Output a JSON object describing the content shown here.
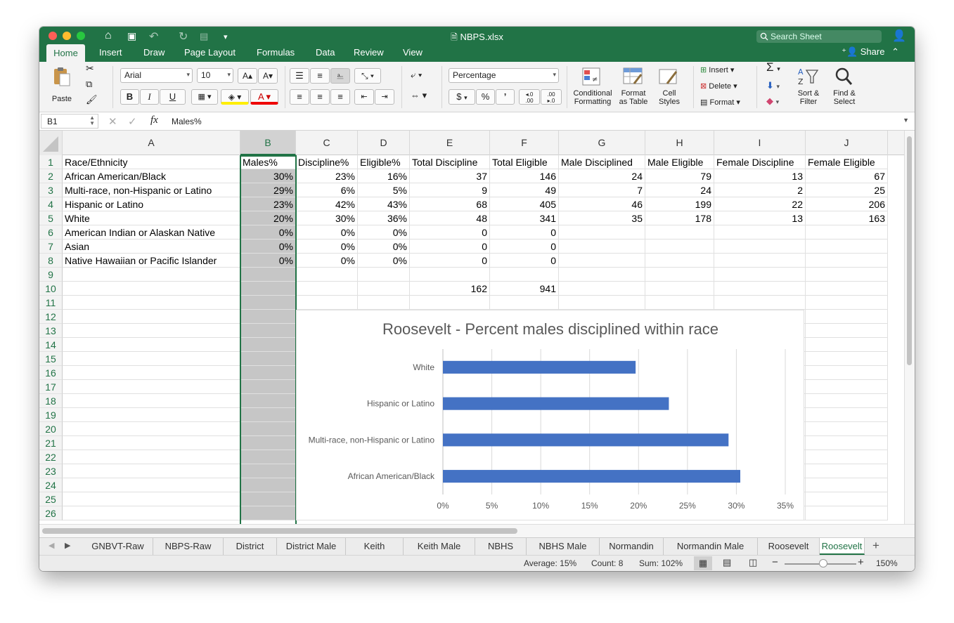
{
  "window": {
    "title": "NBPS.xlsx",
    "search_placeholder": "Search Sheet",
    "share_label": "Share"
  },
  "menu_tabs": [
    "Home",
    "Insert",
    "Draw",
    "Page Layout",
    "Formulas",
    "Data",
    "Review",
    "View"
  ],
  "ribbon": {
    "paste": "Paste",
    "font_name": "Arial",
    "font_size": "10",
    "number_format": "Percentage",
    "conditional_formatting": [
      "Conditional",
      "Formatting"
    ],
    "format_as_table": [
      "Format",
      "as Table"
    ],
    "cell_styles": [
      "Cell",
      "Styles"
    ],
    "insert": "Insert",
    "delete": "Delete",
    "format": "Format",
    "sort_filter": [
      "Sort &",
      "Filter"
    ],
    "find_select": [
      "Find &",
      "Select"
    ],
    "bold": "B",
    "italic": "I",
    "underline": "U",
    "currency": "$",
    "percent": "%",
    "comma": "’"
  },
  "formula_bar": {
    "name_box": "B1",
    "fx": "fx",
    "content": "Males%"
  },
  "columns": [
    "A",
    "B",
    "C",
    "D",
    "E",
    "F",
    "G",
    "H",
    "I",
    "J"
  ],
  "rows": [
    [
      "Race/Ethnicity",
      "Males%",
      "Discipline%",
      "Eligible%",
      "Total Discipline",
      "Total Eligible",
      "Male Disciplined",
      "Male Eligible",
      "Female Discipline",
      "Female Eligible"
    ],
    [
      "African American/Black",
      "30%",
      "23%",
      "16%",
      "37",
      "146",
      "24",
      "79",
      "13",
      "67"
    ],
    [
      "Multi-race, non-Hispanic or Latino",
      "29%",
      "6%",
      "5%",
      "9",
      "49",
      "7",
      "24",
      "2",
      "25"
    ],
    [
      "Hispanic or Latino",
      "23%",
      "42%",
      "43%",
      "68",
      "405",
      "46",
      "199",
      "22",
      "206"
    ],
    [
      "White",
      "20%",
      "30%",
      "36%",
      "48",
      "341",
      "35",
      "178",
      "13",
      "163"
    ],
    [
      "American Indian or Alaskan Native",
      "0%",
      "0%",
      "0%",
      "0",
      "0",
      "",
      "",
      "",
      ""
    ],
    [
      "Asian",
      "0%",
      "0%",
      "0%",
      "0",
      "0",
      "",
      "",
      "",
      ""
    ],
    [
      "Native Hawaiian or Pacific Islander",
      "0%",
      "0%",
      "0%",
      "0",
      "0",
      "",
      "",
      "",
      ""
    ],
    [
      "",
      "",
      "",
      "",
      "",
      "",
      "",
      "",
      "",
      ""
    ],
    [
      "",
      "",
      "",
      "",
      "162",
      "941",
      "",
      "",
      "",
      ""
    ],
    [
      "",
      "",
      "",
      "",
      "",
      "",
      "",
      "",
      "",
      ""
    ],
    [
      "",
      "",
      "",
      "",
      "",
      "",
      "",
      "",
      "",
      ""
    ],
    [
      "",
      "",
      "",
      "",
      "",
      "",
      "",
      "",
      "",
      ""
    ],
    [
      "",
      "",
      "",
      "",
      "",
      "",
      "",
      "",
      "",
      ""
    ],
    [
      "",
      "",
      "",
      "",
      "",
      "",
      "",
      "",
      "",
      ""
    ],
    [
      "",
      "",
      "",
      "",
      "",
      "",
      "",
      "",
      "",
      ""
    ],
    [
      "",
      "",
      "",
      "",
      "",
      "",
      "",
      "",
      "",
      ""
    ],
    [
      "",
      "",
      "",
      "",
      "",
      "",
      "",
      "",
      "",
      ""
    ],
    [
      "",
      "",
      "",
      "",
      "",
      "",
      "",
      "",
      "",
      ""
    ],
    [
      "",
      "",
      "",
      "",
      "",
      "",
      "",
      "",
      "",
      ""
    ],
    [
      "",
      "",
      "",
      "",
      "",
      "",
      "",
      "",
      "",
      ""
    ],
    [
      "",
      "",
      "",
      "",
      "",
      "",
      "",
      "",
      "",
      ""
    ],
    [
      "",
      "",
      "",
      "",
      "",
      "",
      "",
      "",
      "",
      ""
    ],
    [
      "",
      "",
      "",
      "",
      "",
      "",
      "",
      "",
      "",
      ""
    ],
    [
      "",
      "",
      "",
      "",
      "",
      "",
      "",
      "",
      "",
      ""
    ],
    [
      "",
      "",
      "",
      "",
      "",
      "",
      "",
      "",
      "",
      ""
    ]
  ],
  "row_numbers": [
    "1",
    "2",
    "3",
    "4",
    "5",
    "6",
    "7",
    "8",
    "9",
    "10",
    "11",
    "12",
    "13",
    "14",
    "15",
    "16",
    "17",
    "18",
    "19",
    "20",
    "21",
    "22",
    "23",
    "24",
    "25",
    "26"
  ],
  "chart_data": {
    "type": "bar",
    "orientation": "horizontal",
    "title": "Roosevelt - Percent males disciplined within race",
    "categories": [
      "White",
      "Hispanic or Latino",
      "Multi-race, non-Hispanic or Latino",
      "African American/Black"
    ],
    "values": [
      0.197,
      0.231,
      0.292,
      0.304
    ],
    "xlim": [
      0,
      0.35
    ],
    "xticks": [
      "0%",
      "5%",
      "10%",
      "15%",
      "20%",
      "25%",
      "30%",
      "35%"
    ],
    "color": "#4472c4",
    "grid": "vertical"
  },
  "sheet_tabs": [
    "GNBVT-Raw",
    "NBPS-Raw",
    "District",
    "District Male",
    "Keith",
    "Keith Male",
    "NBHS",
    "NBHS Male",
    "Normandin",
    "Normandin Male",
    "Roosevelt",
    "Roosevelt"
  ],
  "status": {
    "average": "Average: 15%",
    "count": "Count: 8",
    "sum": "Sum: 102%",
    "zoom": "150%"
  },
  "colors": {
    "accent": "#217346",
    "bar": "#4472c4"
  }
}
